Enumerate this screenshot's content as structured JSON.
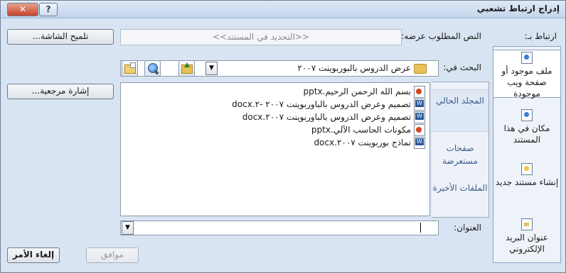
{
  "window": {
    "title": "إدراج ارتباط تشعبي",
    "close_label": "✕",
    "help_label": "?"
  },
  "link_to": {
    "label": "ارتباط بـ:",
    "items": [
      {
        "label": "ملف موجود أو صفحة ويب موجودة",
        "icon": "existing-file-icon",
        "active": true
      },
      {
        "label": "مكان في هذا المستند",
        "icon": "place-in-document-icon",
        "active": false
      },
      {
        "label": "إنشاء مستند جديد",
        "icon": "new-document-icon",
        "active": false
      },
      {
        "label": "عنوان البريد الإلكتروني",
        "icon": "email-address-icon",
        "active": false
      }
    ]
  },
  "text_to_display": {
    "label": "النص المطلوب عرضه:",
    "value": "<<التحديد في المستند>>"
  },
  "screentip_button": "تلميح الشاشة...",
  "look_in": {
    "label": "البحث في:",
    "value": "عرض الدروس بالبوربوينت ٢٠٠٧"
  },
  "bookmark_button": "إشارة مرجعية...",
  "sidebar": [
    {
      "label": "المجلد الحالي",
      "active": true
    },
    {
      "label": "صفحات مستعرضة",
      "active": false
    },
    {
      "label": "الملفات الأخيرة",
      "active": false
    }
  ],
  "files": [
    {
      "name": "بسم الله الرحمن الرحيم.pptx",
      "type": "ppt"
    },
    {
      "name": "تصميم وعرض الدروس بالباوربوينت ٢٠٠٧ -٢.docx",
      "type": "doc"
    },
    {
      "name": "تصميم وعرض الدروس بالباوربوينت ٢٠٠٧.docx",
      "type": "doc"
    },
    {
      "name": "مكونات الحاسب الآلي.pptx",
      "type": "ppt"
    },
    {
      "name": "نماذج بوربوينت ٢٠٠٧.docx",
      "type": "doc"
    }
  ],
  "address": {
    "label": "العنوان:",
    "value": ""
  },
  "ok_button": "موافق",
  "cancel_button": "إلغاء الأمر",
  "colors": {
    "dialog_bg": "#d9e4f2",
    "close_red": "#c7442b",
    "link_blue": "#3a5d8e"
  }
}
